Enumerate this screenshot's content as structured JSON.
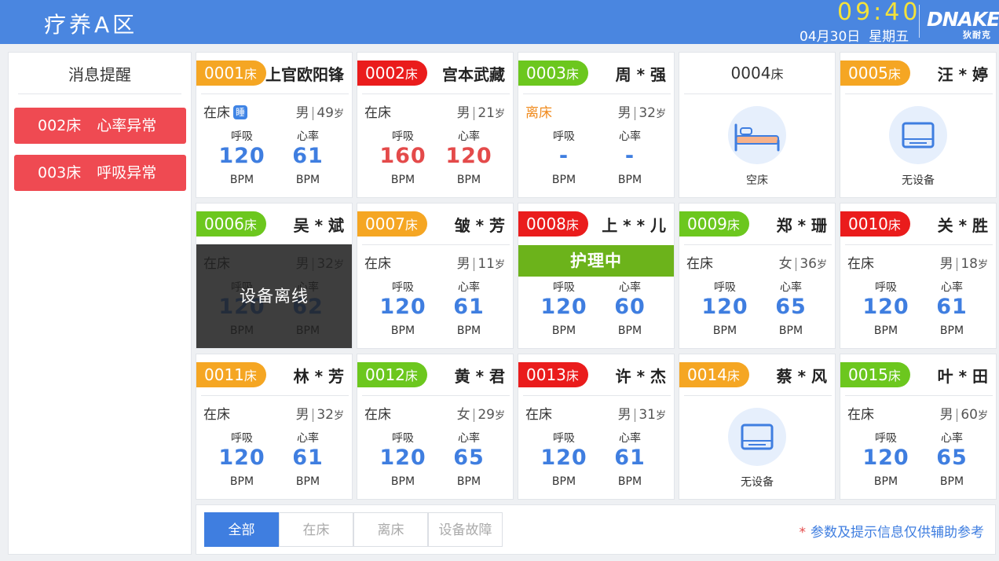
{
  "header": {
    "title": "疗养A区",
    "time": "09:40",
    "date": "04月30日",
    "weekday": "星期五",
    "logo": "DNAKE",
    "logo_sub": "狄耐克"
  },
  "messages": {
    "title": "消息提醒",
    "alerts": [
      {
        "bed": "002床",
        "text": "心率异常"
      },
      {
        "bed": "003床",
        "text": "呼吸异常"
      }
    ]
  },
  "labels": {
    "breath": "呼吸",
    "heart": "心率",
    "unit": "BPM",
    "bed_suffix": "床",
    "age_suffix": "岁",
    "sleep": "睡",
    "empty_bed": "空床",
    "no_device": "无设备",
    "offline": "设备离线",
    "nursing": "护理中"
  },
  "beds": [
    {
      "no": "0001",
      "name": "上官欧阳锋",
      "status": "在床",
      "gender": "男",
      "age": "49",
      "breath": "120",
      "heart": "61"
    },
    {
      "no": "0002",
      "name": "宫本武藏",
      "status": "在床",
      "gender": "男",
      "age": "21",
      "breath": "160",
      "heart": "120"
    },
    {
      "no": "0003",
      "name": "周 * 强",
      "status": "离床",
      "gender": "男",
      "age": "32",
      "breath": "-",
      "heart": "-"
    },
    {
      "no": "0004"
    },
    {
      "no": "0005",
      "name": "汪 * 婷"
    },
    {
      "no": "0006",
      "name": "吴 * 斌",
      "status": "在床",
      "gender": "男",
      "age": "32",
      "breath": "120",
      "heart": "62"
    },
    {
      "no": "0007",
      "name": "皱 * 芳",
      "status": "在床",
      "gender": "男",
      "age": "11",
      "breath": "120",
      "heart": "61"
    },
    {
      "no": "0008",
      "name": "上 * * 儿",
      "breath": "120",
      "heart": "60"
    },
    {
      "no": "0009",
      "name": "郑 * 珊",
      "status": "在床",
      "gender": "女",
      "age": "36",
      "breath": "120",
      "heart": "65"
    },
    {
      "no": "0010",
      "name": "关 * 胜",
      "status": "在床",
      "gender": "男",
      "age": "18",
      "breath": "120",
      "heart": "61"
    },
    {
      "no": "0011",
      "name": "林 * 芳",
      "status": "在床",
      "gender": "男",
      "age": "32",
      "breath": "120",
      "heart": "61"
    },
    {
      "no": "0012",
      "name": "黄 * 君",
      "status": "在床",
      "gender": "女",
      "age": "29",
      "breath": "120",
      "heart": "65"
    },
    {
      "no": "0013",
      "name": "许 * 杰",
      "status": "在床",
      "gender": "男",
      "age": "31",
      "breath": "120",
      "heart": "61"
    },
    {
      "no": "0014",
      "name": "蔡 * 风"
    },
    {
      "no": "0015",
      "name": "叶 * 田",
      "status": "在床",
      "gender": "男",
      "age": "60",
      "breath": "120",
      "heart": "65"
    }
  ],
  "filters": [
    "全部",
    "在床",
    "离床",
    "设备故障"
  ],
  "note": "参数及提示信息仅供辅助参考",
  "colors": {
    "header": "#4a86e0",
    "time": "#f4e23a",
    "orange_tag": "#f5a623",
    "red_tag": "#ea1c1c",
    "green_tag": "#6cc71e",
    "value_blue": "#3f7ee0",
    "value_red": "#e44a4a",
    "alert": "#ef4a52"
  }
}
